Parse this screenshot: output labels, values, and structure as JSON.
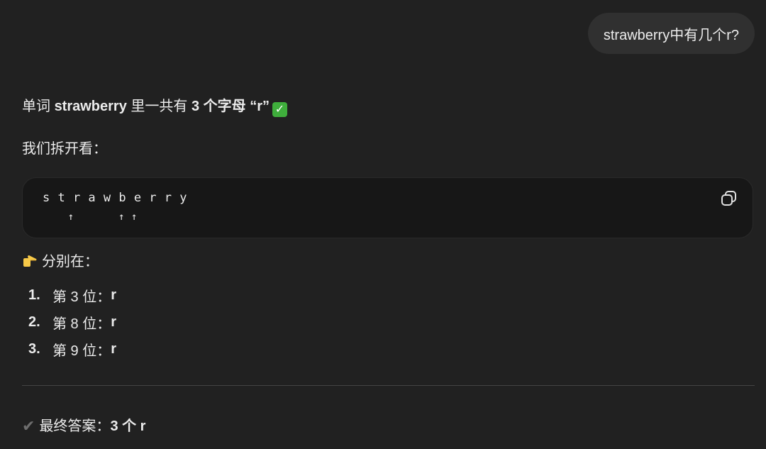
{
  "user_message": {
    "text": "strawberry中有几个r?"
  },
  "answer": {
    "intro": {
      "prefix": "单词 ",
      "word": "strawberry",
      "middle": " 里一共有 ",
      "count_text": "3 个字母 “r”",
      "emoji": "✅"
    },
    "breakdown_label": "我们拆开看：",
    "code_block": {
      "line1": "s t r a w b e r r y",
      "line2": "    ↑       ↑ ↑"
    },
    "positions_label": "分别在：",
    "positions": [
      {
        "num": "1.",
        "text": "第 3 位：",
        "letter": "r"
      },
      {
        "num": "2.",
        "text": "第 8 位：",
        "letter": "r"
      },
      {
        "num": "3.",
        "text": "第 9 位：",
        "letter": "r"
      }
    ],
    "final": {
      "label": "最终答案：",
      "value": "3 个 r"
    }
  },
  "icons": {
    "copy": "copy-icon",
    "pointing_hand": "pointing-right-icon",
    "check_mark": "check-mark-icon",
    "check_box": "check-box-emoji-icon"
  },
  "colors": {
    "background": "#212121",
    "bubble": "#303030",
    "code_bg": "#171717",
    "check_green": "#3fae3c"
  }
}
